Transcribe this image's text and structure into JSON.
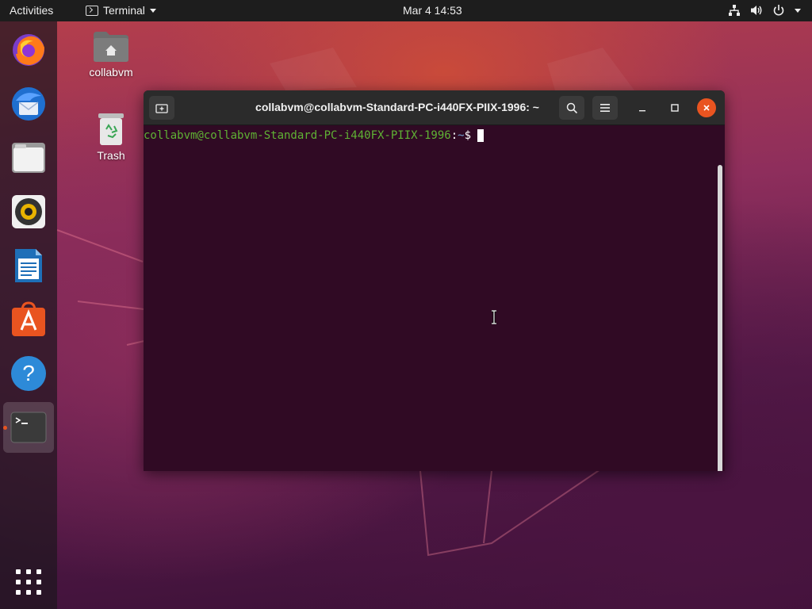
{
  "topbar": {
    "activities": "Activities",
    "app_menu": "Terminal",
    "clock": "Mar 4  14:53",
    "tray_icons": [
      "network-icon",
      "volume-icon",
      "power-icon",
      "chevron-down-icon"
    ]
  },
  "dock": {
    "items": [
      {
        "name": "Firefox",
        "icon": "firefox-icon"
      },
      {
        "name": "Thunderbird",
        "icon": "thunderbird-icon"
      },
      {
        "name": "Files",
        "icon": "files-icon"
      },
      {
        "name": "Rhythmbox",
        "icon": "rhythmbox-icon"
      },
      {
        "name": "LibreOffice Writer",
        "icon": "writer-icon"
      },
      {
        "name": "Ubuntu Software",
        "icon": "software-icon"
      },
      {
        "name": "Help",
        "icon": "help-icon"
      },
      {
        "name": "Terminal",
        "icon": "terminal-icon",
        "running": true
      }
    ],
    "show_apps_icon": "grid-icon"
  },
  "desktop": {
    "icons": [
      {
        "label": "collabvm",
        "icon": "home-folder-icon"
      },
      {
        "label": "Trash",
        "icon": "trash-icon"
      }
    ]
  },
  "terminal": {
    "title": "collabvm@collabvm-Standard-PC-i440FX-PIIX-1996: ~",
    "prompt_user_host": "collabvm@collabvm-Standard-PC-i440FX-PIIX-1996",
    "prompt_colon": ":",
    "prompt_path": "~",
    "prompt_symbol": "$ "
  },
  "colors": {
    "accent": "#e95420",
    "terminal_bg": "#300a24",
    "prompt_user": "#5fb234",
    "prompt_path": "#729fcf"
  }
}
